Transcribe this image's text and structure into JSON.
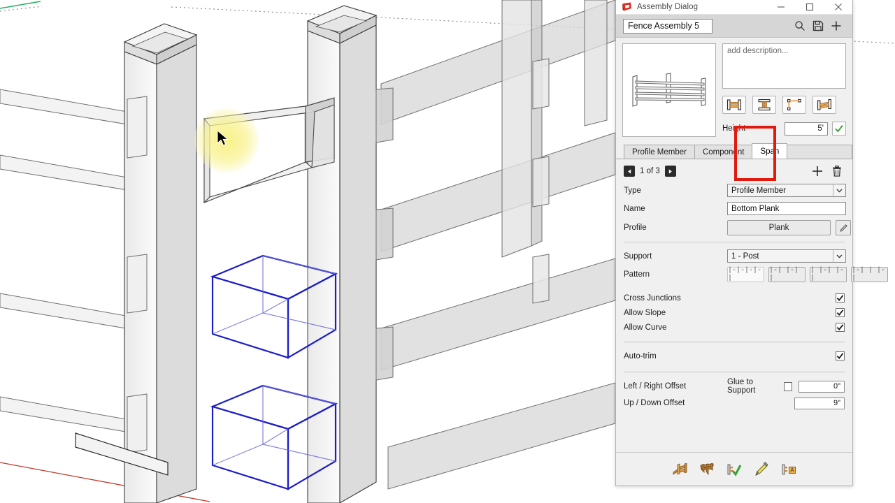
{
  "window": {
    "title": "Assembly Dialog",
    "app_icon": "sketchup-icon",
    "minimize_label": "─",
    "maximize_label": "□",
    "close_label": "✕"
  },
  "toolbar": {
    "assembly_name": "Fence Assembly 5",
    "search_icon": "search-icon",
    "save_icon": "save-icon",
    "add_icon": "plus-icon"
  },
  "preview": {
    "thumbnail_alt": "fence-assembly-thumbnail",
    "description_placeholder": "add description...",
    "description_value": ""
  },
  "orientation_buttons": [
    {
      "name": "horizontal-span-icon",
      "label": ""
    },
    {
      "name": "vertical-span-icon",
      "label": ""
    },
    {
      "name": "corner-span-icon",
      "label": ""
    },
    {
      "name": "sloped-span-icon",
      "label": ""
    }
  ],
  "height": {
    "label": "Height",
    "value": "5'",
    "confirm_icon": "check-icon"
  },
  "tabs": [
    {
      "id": "profile-member",
      "label": "Profile Member",
      "active": false
    },
    {
      "id": "component",
      "label": "Component",
      "active": false
    },
    {
      "id": "span",
      "label": "Span",
      "active": true
    }
  ],
  "annotation": {
    "color": "#e01b0e",
    "target": "span-tab"
  },
  "navigation": {
    "prev_icon": "triangle-left-icon",
    "next_icon": "triangle-right-icon",
    "counter": "1 of 3",
    "add_icon": "plus-icon",
    "delete_icon": "trash-icon"
  },
  "fields": {
    "type": {
      "label": "Type",
      "value": "Profile Member"
    },
    "name": {
      "label": "Name",
      "value": "Bottom Plank"
    },
    "profile": {
      "label": "Profile",
      "value": "Plank",
      "edit_icon": "pencil-icon"
    },
    "support": {
      "label": "Support",
      "value": "1 - Post"
    },
    "pattern": {
      "label": "Pattern",
      "options": [
        {
          "glyph": "|-|-|-|-|",
          "selected": true
        },
        {
          "glyph": "|-| |-| |",
          "selected": false
        },
        {
          "glyph": "| |-| |-|",
          "selected": false
        },
        {
          "glyph": "|-| | |-|",
          "selected": false
        }
      ]
    }
  },
  "checkboxes": [
    {
      "label": "Cross Junctions",
      "checked": true
    },
    {
      "label": "Allow Slope",
      "checked": true
    },
    {
      "label": "Allow Curve",
      "checked": true
    }
  ],
  "autotrim": {
    "label": "Auto-trim",
    "checked": true
  },
  "offsets": {
    "left_right": {
      "label": "Left / Right Offset",
      "value": "0\""
    },
    "up_down": {
      "label": "Up / Down Offset",
      "value": "9\""
    },
    "glue_to_support": {
      "label": "Glue to Support",
      "checked": false
    }
  },
  "footer_icons": [
    {
      "name": "build-fence-icon"
    },
    {
      "name": "edit-fence-icon"
    },
    {
      "name": "apply-check-icon"
    },
    {
      "name": "eyedropper-icon"
    },
    {
      "name": "assembly-attribute-icon"
    }
  ],
  "viewport": {
    "cursor": "arrow-cursor",
    "selection_color": "#1d1dc8",
    "hover_highlight_color": "#f8f182",
    "axis_red": "#c0392b",
    "axis_green": "#27ae60",
    "model": "fence-assembly-3d-model"
  }
}
